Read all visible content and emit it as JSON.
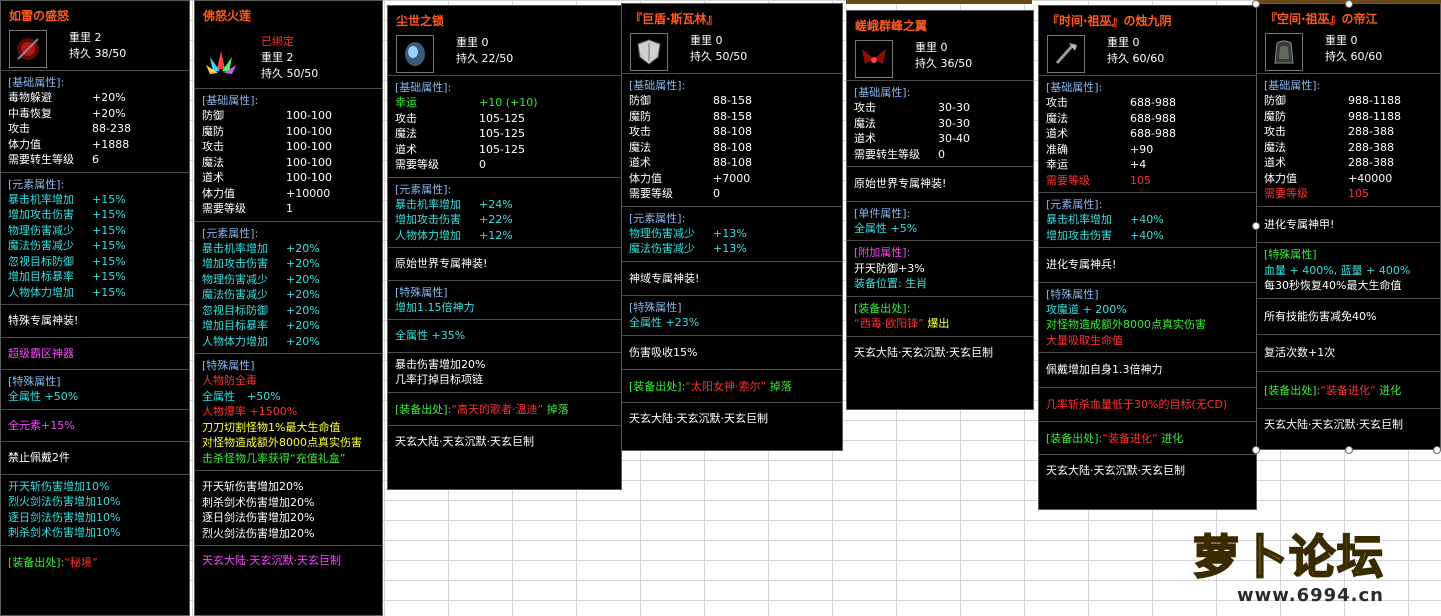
{
  "colors": {
    "title": "#ff5a1e",
    "section": "#87b5ea",
    "cyan": "#33e0e0",
    "green": "#33ee33",
    "red": "#ff3030",
    "yellow": "#ffff3c",
    "magenta": "#ff44ff"
  },
  "logo": {
    "text": "萝卜论坛",
    "url": "www.6994.cn"
  },
  "p1": {
    "title": "如雷の盛怒",
    "weight": "重里 2",
    "dur": "持久 38/50",
    "base_title": "[基础属性]:",
    "base": [
      [
        "毒物躲避",
        "+20%"
      ],
      [
        "中毒恢复",
        "+20%"
      ],
      [
        "攻击",
        "88-238"
      ],
      [
        "体力值",
        "+1888"
      ],
      [
        "需要转生等级",
        "6"
      ]
    ],
    "elem_title": "[元素属性]:",
    "elem": [
      [
        "暴击机率增加",
        "+15%"
      ],
      [
        "增加攻击伤害",
        "+15%"
      ],
      [
        "物理伤害减少",
        "+15%"
      ],
      [
        "魔法伤害减少",
        "+15%"
      ],
      [
        "忽视目标防御",
        "+15%"
      ],
      [
        "增加目标暴率",
        "+15%"
      ],
      [
        "人物体力增加",
        "+15%"
      ]
    ],
    "s1": "特殊专属神装!",
    "s2": "超级霸区神器",
    "sp_title": "[特殊属性]",
    "sp1": "全属性 +50%",
    "s3": "全元素+15%",
    "s4": "禁止佩戴2件",
    "skills": [
      "开天斩伤害增加10%",
      "烈火剑法伤害增加10%",
      "逐日剑法伤害增加10%",
      "刺杀剑术伤害增加10%"
    ],
    "src_title": "[装备出处]:",
    "src": "“秘境”"
  },
  "p2": {
    "title": "佛怒火莲",
    "bound": "已绑定",
    "weight": "重里 2",
    "dur": "持久 50/50",
    "base_title": "[基础属性]:",
    "base": [
      [
        "防御",
        "100-100"
      ],
      [
        "魔防",
        "100-100"
      ],
      [
        "攻击",
        "100-100"
      ],
      [
        "魔法",
        "100-100"
      ],
      [
        "道术",
        "100-100"
      ],
      [
        "体力值",
        "+10000"
      ],
      [
        "需要等级",
        "1"
      ]
    ],
    "elem_title": "[元素属性]:",
    "elem": [
      [
        "暴击机率增加",
        "+20%"
      ],
      [
        "增加攻击伤害",
        "+20%"
      ],
      [
        "物理伤害减少",
        "+20%"
      ],
      [
        "魔法伤害减少",
        "+20%"
      ],
      [
        "忽视目标防御",
        "+20%"
      ],
      [
        "增加目标暴率",
        "+20%"
      ],
      [
        "人物体力增加",
        "+20%"
      ]
    ],
    "sp_title": "[特殊属性]",
    "sp_red": "人物防全毒",
    "sp_a_k": "全属性",
    "sp_a_v": "+50%",
    "sp_b": "人物爆率 +1500%",
    "sp_y1": "刀刀切割怪物1%最大生命值",
    "sp_y2": "对怪物造成额外8000点真实伤害",
    "sp_g": "击杀怪物几率获得“充值礼盒”",
    "skills": [
      "开天斩伤害增加20%",
      "刺杀剑术伤害增加20%",
      "逐日剑法伤害增加20%",
      "烈火剑法伤害增加20%"
    ],
    "footer": "天玄大陆·天玄沉默·天玄巨制"
  },
  "p3": {
    "title": "尘世之锁",
    "weight": "重里 0",
    "dur": "持久 22/50",
    "base_title": "[基础属性]:",
    "luck_k": "幸运",
    "luck_v": "+10 (+10)",
    "base": [
      [
        "攻击",
        "105-125"
      ],
      [
        "魔法",
        "105-125"
      ],
      [
        "道术",
        "105-125"
      ],
      [
        "需要等级",
        "0"
      ]
    ],
    "elem_title": "[元素属性]:",
    "elem": [
      [
        "暴击机率增加",
        "+24%"
      ],
      [
        "增加攻击伤害",
        "+22%"
      ],
      [
        "人物体力增加",
        "+12%"
      ]
    ],
    "s1": "原始世界专属神装!",
    "sp_title": "[特殊属性]",
    "sp1": "增加1.15倍神力",
    "s2": "全属性 +35%",
    "s3a": "暴击伤害增加20%",
    "s3b": "几率打掉目标项链",
    "src_title": "[装备出处]:",
    "src": "“高天的歌者·温迪”",
    "src_end": "掉落",
    "footer": "天玄大陆·天玄沉默·天玄巨制"
  },
  "p4": {
    "title": "『巨盾·斯瓦林』",
    "weight": "重里 0",
    "dur": "持久 50/50",
    "base_title": "[基础属性]:",
    "base": [
      [
        "防御",
        "88-158"
      ],
      [
        "魔防",
        "88-158"
      ],
      [
        "攻击",
        "88-108"
      ],
      [
        "魔法",
        "88-108"
      ],
      [
        "道术",
        "88-108"
      ],
      [
        "体力值",
        "+7000"
      ],
      [
        "需要等级",
        "0"
      ]
    ],
    "elem_title": "[元素属性]:",
    "elem": [
      [
        "物理伤害减少",
        "+13%"
      ],
      [
        "魔法伤害减少",
        "+13%"
      ]
    ],
    "s1": "神域专属神装!",
    "sp_title": "[特殊属性]",
    "sp1": "全属性 +23%",
    "s2": "伤害吸收15%",
    "src_title": "[装备出处]:",
    "src": "“太阳女神·索尔”",
    "src_end": "掉落",
    "footer": "天玄大陆·天玄沉默·天玄巨制"
  },
  "p5": {
    "title": "嵯峨群峰之翼",
    "weight": "重里 0",
    "dur": "持久 36/50",
    "base_title": "[基础属性]:",
    "base": [
      [
        "攻击",
        "30-30"
      ],
      [
        "魔法",
        "30-30"
      ],
      [
        "道术",
        "30-40"
      ],
      [
        "需要转生等级",
        "0"
      ]
    ],
    "s1": "原始世界专属神装!",
    "single_title": "[单件属性]:",
    "single": "全属性 +5%",
    "add_title": "[附加属性]:",
    "add1": "开天防御+3%",
    "add2": "装备位置: 生肖",
    "src_title": "[装备出处]:",
    "src": "“西毒·欧阳锋”",
    "src_end": "爆出",
    "footer": "天玄大陆·天玄沉默·天玄巨制"
  },
  "p6": {
    "title": "『时间·祖巫』の烛九阴",
    "weight": "重里 0",
    "dur": "持久 60/60",
    "base_title": "[基础属性]:",
    "base": [
      [
        "攻击",
        "688-988"
      ],
      [
        "魔法",
        "688-988"
      ],
      [
        "道术",
        "688-988"
      ],
      [
        "准确",
        "+90"
      ],
      [
        "幸运",
        "+4"
      ]
    ],
    "req_k": "需要等级",
    "req_v": "105",
    "elem_title": "[元素属性]:",
    "elem": [
      [
        "暴击机率增加",
        "+40%"
      ],
      [
        "增加攻击伤害",
        "+40%"
      ]
    ],
    "s1": "进化专属神兵!",
    "sp_title": "[特殊属性]",
    "sp1": "攻魔道 + 200%",
    "sp2": "对怪物造成额外8000点真实伤害",
    "sp3": "大量吸取生命值",
    "s2": "佩戴增加自身1.3倍神力",
    "s3": "几率斩杀血量低于30%的目标(无CD)",
    "src_title": "[装备出处]:",
    "src": "“装备进化”",
    "src_end": "进化",
    "footer": "天玄大陆·天玄沉默·天玄巨制"
  },
  "p7": {
    "title": "『空间·祖巫』の帝江",
    "weight": "重里 0",
    "dur": "持久 60/60",
    "base_title": "[基础属性]:",
    "base": [
      [
        "防御",
        "988-1188"
      ],
      [
        "魔防",
        "988-1188"
      ],
      [
        "攻击",
        "288-388"
      ],
      [
        "魔法",
        "288-388"
      ],
      [
        "道术",
        "288-388"
      ],
      [
        "体力值",
        "+40000"
      ]
    ],
    "req_k": "需要等级",
    "req_v": "105",
    "s1": "进化专属神甲!",
    "sp_title": "[特殊属性]",
    "sp1": "血量 + 400%, 蓝量 + 400%",
    "sp2": "每30秒恢复40%最大生命值",
    "s2": "所有技能伤害减免40%",
    "s3": "复活次数+1次",
    "src_title": "[装备出处]:",
    "src": "“装备进化”",
    "src_end": "进化",
    "footer": "天玄大陆·天玄沉默·天玄巨制"
  }
}
